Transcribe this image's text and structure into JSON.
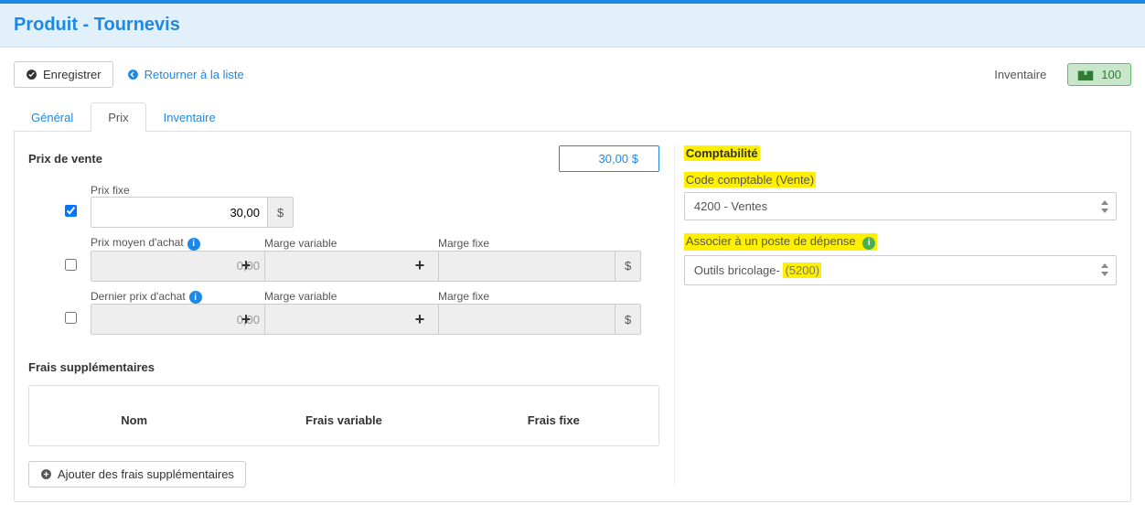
{
  "header": {
    "title": "Produit - Tournevis"
  },
  "toolbar": {
    "save_label": "Enregistrer",
    "back_label": "Retourner à la liste",
    "inventory_label": "Inventaire",
    "inventory_value": "100"
  },
  "tabs": {
    "general": "Général",
    "price": "Prix",
    "inventory": "Inventaire"
  },
  "price": {
    "heading": "Prix de vente",
    "badge": "30,00 $",
    "fixed_label": "Prix fixe",
    "fixed_value": "30,00",
    "avg_label": "Prix moyen d'achat",
    "avg_value": "0,00",
    "last_label": "Dernier prix d'achat",
    "last_value": "0,00",
    "var_margin_label": "Marge variable",
    "fixed_margin_label": "Marge fixe",
    "currency": "$",
    "percent": "%"
  },
  "fees": {
    "heading": "Frais supplémentaires",
    "col_nom": "Nom",
    "col_var": "Frais variable",
    "col_fixed": "Frais fixe",
    "add_btn": "Ajouter des frais supplémentaires"
  },
  "accounting": {
    "heading": "Comptabilité",
    "code_label": "Code comptable (Vente)",
    "code_value": "4200 - Ventes",
    "expense_label": "Associer à un poste de dépense",
    "expense_value_prefix": "Outils bricolage- ",
    "expense_value_suffix": "(5200)"
  }
}
